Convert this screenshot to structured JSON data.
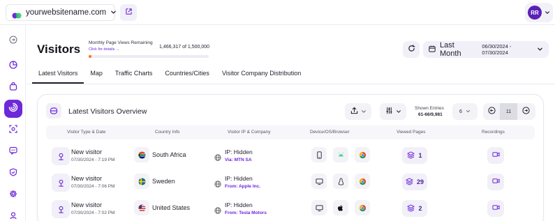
{
  "header": {
    "site_name": "yourwebsitename.com",
    "user_initials": "RR"
  },
  "sidebar": {
    "items": [
      {
        "icon": "collapse-icon"
      },
      {
        "icon": "dashboard-icon"
      },
      {
        "icon": "bag-icon"
      },
      {
        "icon": "visitors-icon",
        "active": true
      },
      {
        "icon": "target-icon"
      },
      {
        "icon": "chat-icon"
      },
      {
        "icon": "shield-icon"
      },
      {
        "icon": "gear-icon"
      },
      {
        "icon": "user-pin-icon"
      }
    ]
  },
  "page": {
    "title": "Visitors",
    "pageviews_label": "Monthly Page Views Remaining",
    "pageviews_link": "Click for details →",
    "pageviews_count": "1,466,317 of 1,500,000",
    "pageviews_used_fraction": 0.022,
    "date_range_label": "Last Month",
    "date_range": "06/30/2024 - 07/30/2024"
  },
  "tabs": [
    {
      "label": "Latest Visitors",
      "active": true
    },
    {
      "label": "Map"
    },
    {
      "label": "Traffic Charts"
    },
    {
      "label": "Countries/Cities"
    },
    {
      "label": "Visitor Company Distribution"
    }
  ],
  "card": {
    "title": "Latest Visitors Overview",
    "shown_label": "Shown Entries",
    "shown_count": "61-66/9,981",
    "per_page": "6",
    "current_page": "11"
  },
  "table": {
    "headers": [
      "Visitor Type & Date",
      "Country Info",
      "Visitor IP & Company",
      "Device/OS/Browser",
      "Viewed Pages",
      "Recordings"
    ],
    "rows": [
      {
        "visitor": "New visitor",
        "date": "07/30/2024 - 7:19 PM",
        "country": "South Africa",
        "flag": "za",
        "ip": "IP: Hidden",
        "company": "Via: MTN SA",
        "device": "phone",
        "os": "android",
        "browser": "chrome",
        "views": "1"
      },
      {
        "visitor": "New visitor",
        "date": "07/30/2024 - 7:06 PM",
        "country": "Sweden",
        "flag": "se",
        "ip": "IP: Hidden",
        "company": "From: Apple Inc.",
        "device": "desktop",
        "os": "linux",
        "browser": "chrome",
        "views": "29"
      },
      {
        "visitor": "New visitor",
        "date": "07/30/2024 - 7:02 PM",
        "country": "United States",
        "flag": "us",
        "ip": "IP: Hidden",
        "company": "From: Tesla Motors",
        "device": "desktop",
        "os": "apple",
        "browser": "chrome",
        "views": "2"
      }
    ]
  },
  "colors": {
    "accent": "#6d28d9",
    "accent_light": "#f1eff8",
    "progress": "#f97316"
  }
}
